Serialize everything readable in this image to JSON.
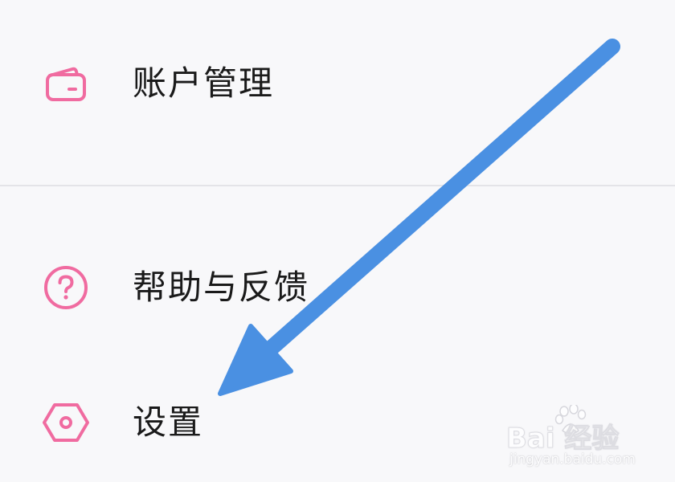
{
  "menu": {
    "items": [
      {
        "id": "account",
        "label": "账户管理",
        "icon": "wallet-icon"
      },
      {
        "id": "help",
        "label": "帮助与反馈",
        "icon": "question-circle-icon"
      },
      {
        "id": "settings",
        "label": "设置",
        "icon": "hexagon-settings-icon"
      }
    ]
  },
  "annotation": {
    "arrow_color": "#4a90e2",
    "points_to": "settings"
  },
  "watermark": {
    "brand": "Bai  经验",
    "url": "jingyan.baidu.com"
  },
  "colors": {
    "icon_accent": "#f06ba0",
    "background": "#f8f8fa",
    "divider": "#e4e4e8",
    "label": "#1a1a1a"
  }
}
